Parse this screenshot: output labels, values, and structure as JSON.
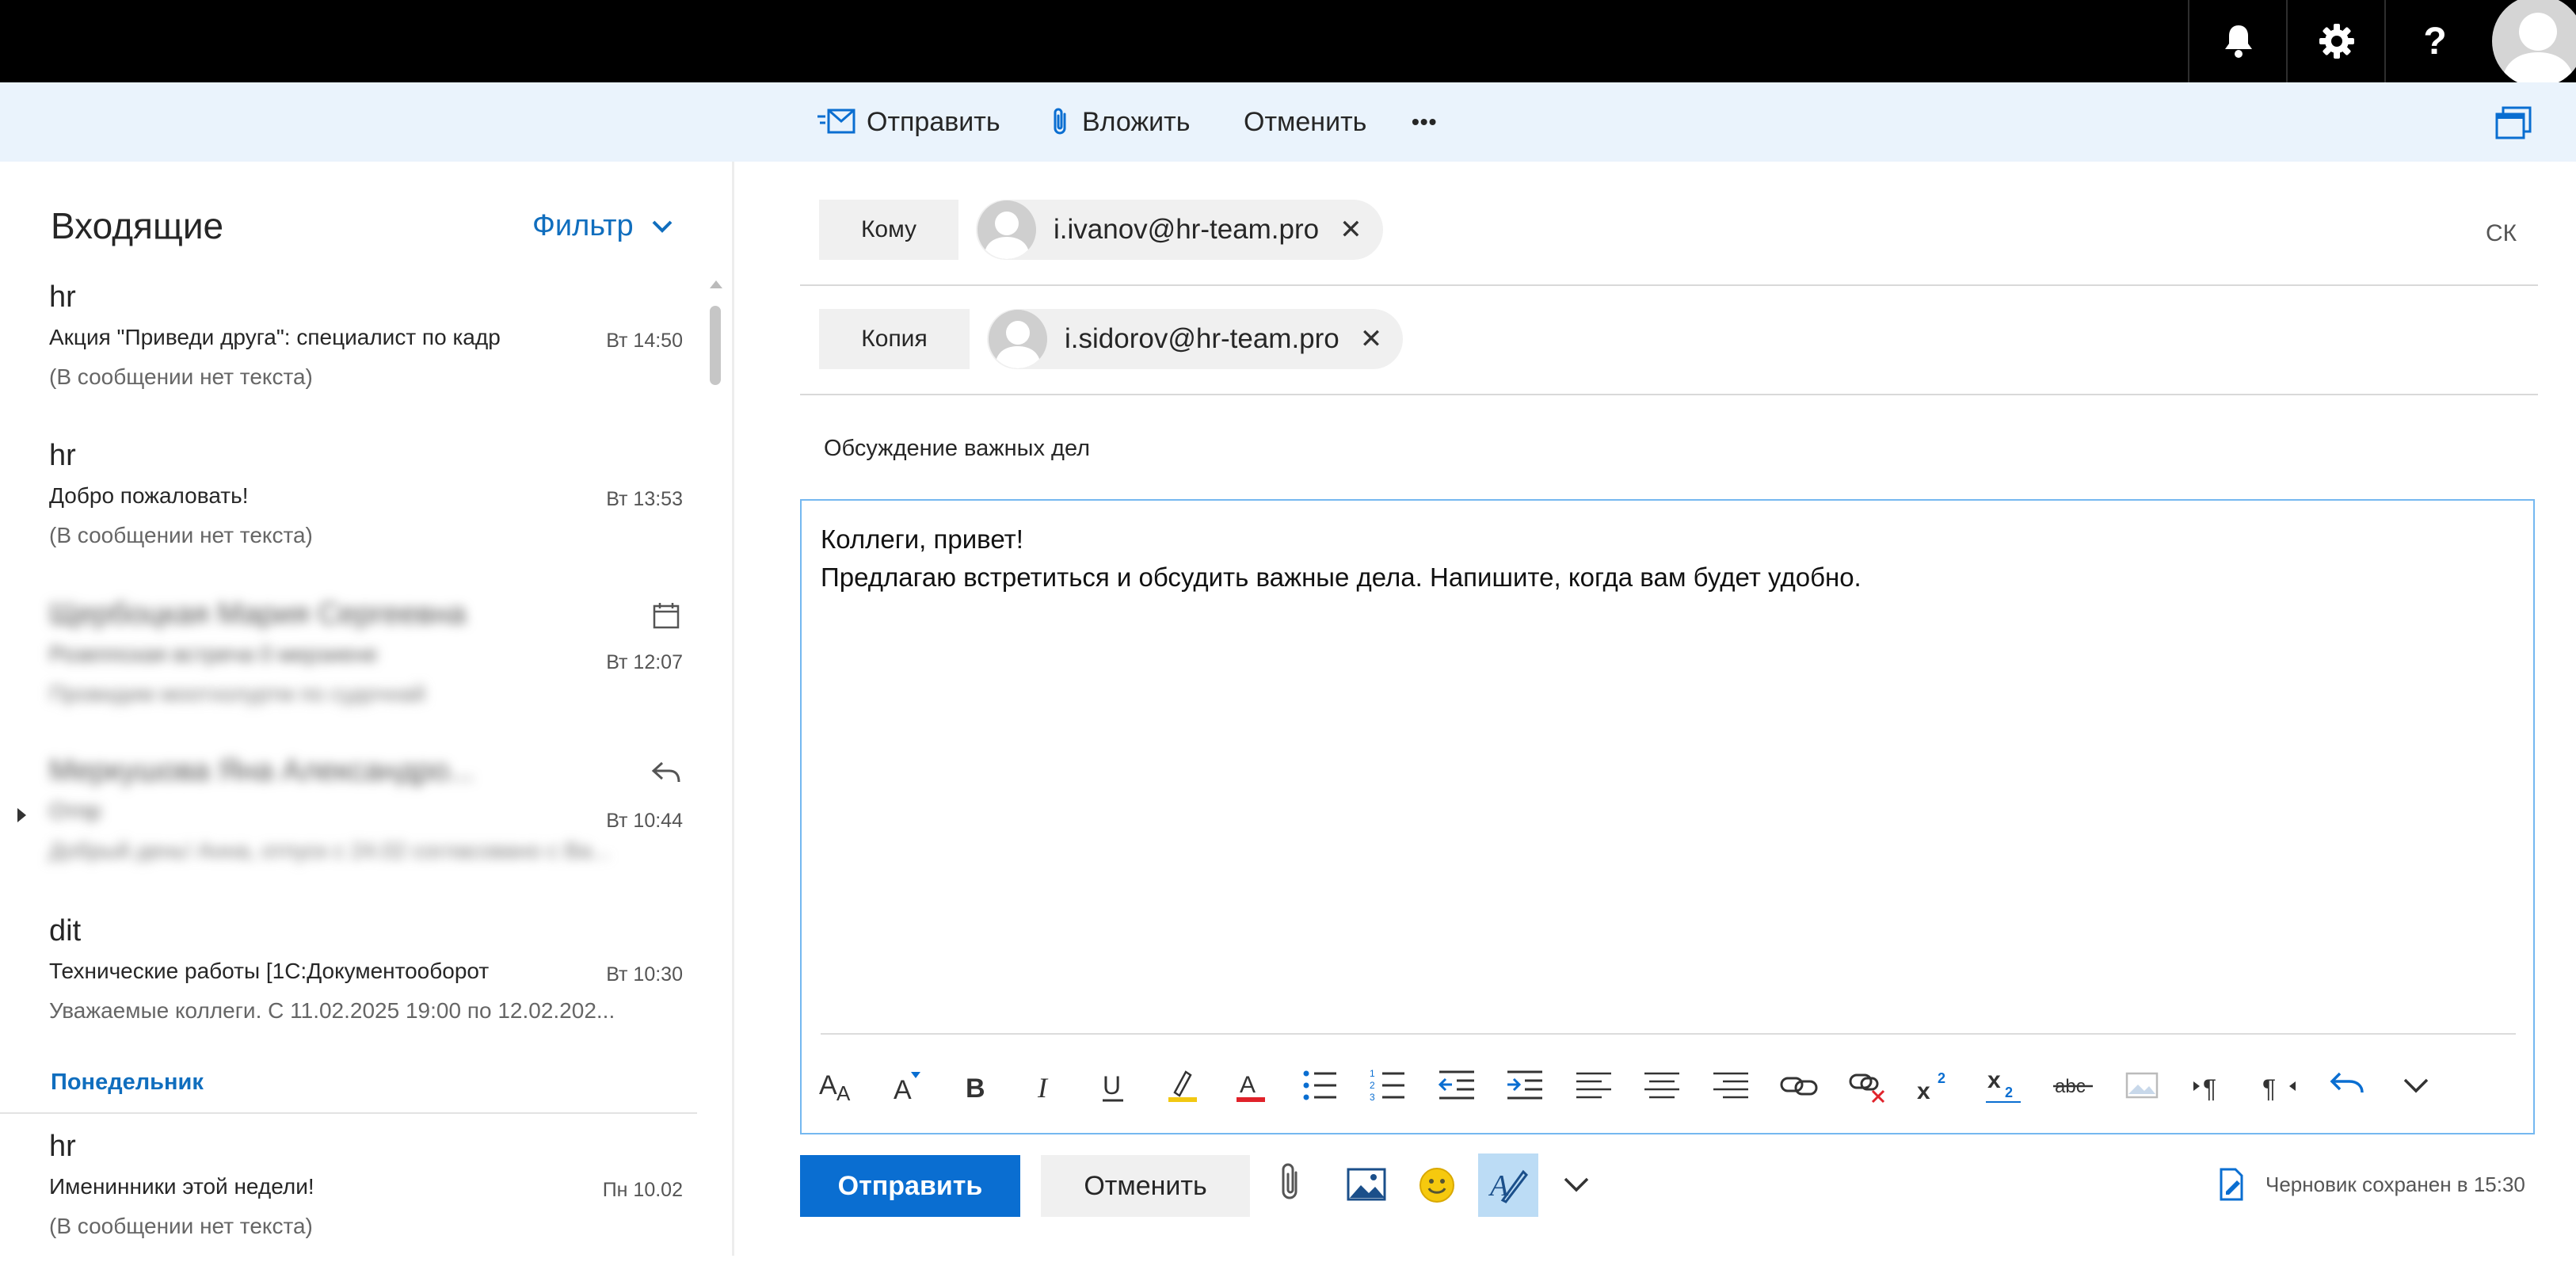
{
  "colors": {
    "accent": "#0a6ed1",
    "top_bar": "#000000",
    "command_bar": "#eaf3fc",
    "editor_border": "#75b8f0",
    "link_blue": "#106ebe"
  },
  "topbar": {
    "icons": [
      "bell-icon",
      "gear-icon",
      "help-icon",
      "user-avatar"
    ],
    "help_glyph": "?"
  },
  "command_bar": {
    "send": "Отправить",
    "attach": "Вложить",
    "discard": "Отменить",
    "more": "•••"
  },
  "inbox": {
    "title": "Входящие",
    "filter": "Фильтр",
    "messages": [
      {
        "sender": "hr",
        "subject": "Акция \"Приведи друга\": специалист по кадр",
        "preview": "(В сообщении нет текста)",
        "time": "Вт 14:50"
      },
      {
        "sender": "hr",
        "subject": "Добро пожаловать!",
        "preview": "(В сообщении нет текста)",
        "time": "Вт 13:53"
      },
      {
        "sender": "Щербоцкая Мария Сергеевна",
        "subject": "Розеппская встреча 0 мерзиене",
        "preview": "Провидим моотхолуртм по судочнай",
        "time": "Вт 12:07",
        "icon": "calendar-icon",
        "blurred": true
      },
      {
        "sender": "Меркушова Яна Александро...",
        "subject": "Отпр",
        "preview": "Добрый день! Анна, отпуск с 24.02 согласовано с Ва...",
        "time": "Вт 10:44",
        "icon": "reply-icon",
        "blurred": true
      },
      {
        "sender": "dit",
        "subject": "Технические работы [1С:Документооборот",
        "preview": "Уважаемые коллеги. С 11.02.2025 19:00 по 12.02.202...",
        "time": "Вт 10:30"
      }
    ],
    "group_label": "Понедельник",
    "messages_monday": [
      {
        "sender": "hr",
        "subject": "Именинники этой недели!",
        "preview": "(В сообщении нет текста)",
        "time": "Пн 10.02"
      }
    ]
  },
  "compose": {
    "to_label": "Кому",
    "to_address": "i.ivanov@hr-team.pro",
    "bcc_label": "СК",
    "cc_label": "Копия",
    "cc_address": "i.sidorov@hr-team.pro",
    "remove_glyph": "✕",
    "subject": "Обсуждение важных дел",
    "body_line1": "Коллеги, привет!",
    "body_line2": "Предлагаю встретиться и обсудить важные дела. Напишите, когда вам будет удобно.",
    "send_button": "Отправить",
    "cancel_button": "Отменить",
    "draft_status": "Черновик сохранен в 15:30"
  },
  "format_toolbar": [
    "font-size-icon",
    "grow-font-icon",
    "bold-icon",
    "italic-icon",
    "underline-icon",
    "highlight-icon",
    "font-color-icon",
    "bullets-icon",
    "numbering-icon",
    "decrease-indent-icon",
    "increase-indent-icon",
    "align-left-icon",
    "align-center-icon",
    "align-right-icon",
    "insert-link-icon",
    "remove-link-icon",
    "superscript-icon",
    "subscript-icon",
    "strikethrough-icon",
    "insert-picture-icon",
    "ltr-icon",
    "rtl-icon",
    "undo-icon",
    "more-options-chevron-icon"
  ]
}
